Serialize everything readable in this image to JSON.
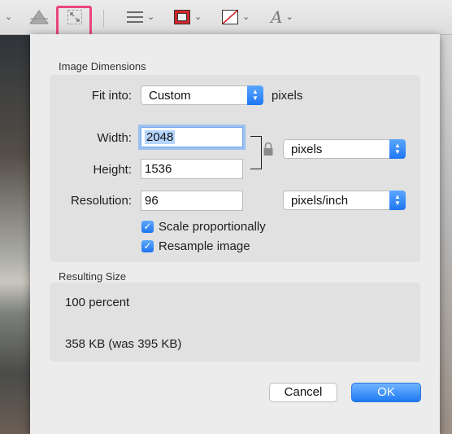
{
  "toolbar": {
    "icons": [
      "adjust-color-icon",
      "adjust-size-icon",
      "shape-style-icon",
      "border-color-icon",
      "fill-color-icon",
      "text-style-icon"
    ],
    "highlight_color": "#e8457a"
  },
  "dialog": {
    "image_dimensions_title": "Image Dimensions",
    "fit_into_label": "Fit into:",
    "fit_into_value": "Custom",
    "fit_into_unit": "pixels",
    "width_label": "Width:",
    "width_value": "2048",
    "height_label": "Height:",
    "height_value": "1536",
    "size_unit_value": "pixels",
    "resolution_label": "Resolution:",
    "resolution_value": "96",
    "resolution_unit_value": "pixels/inch",
    "scale_label": "Scale proportionally",
    "scale_checked": true,
    "resample_label": "Resample image",
    "resample_checked": true,
    "resulting_size_title": "Resulting Size",
    "percent_text": "100 percent",
    "size_text": "358 KB (was 395 KB)",
    "cancel_label": "Cancel",
    "ok_label": "OK"
  },
  "colors": {
    "accent": "#1f7af5",
    "border_color_swatch": "#d3262a"
  }
}
